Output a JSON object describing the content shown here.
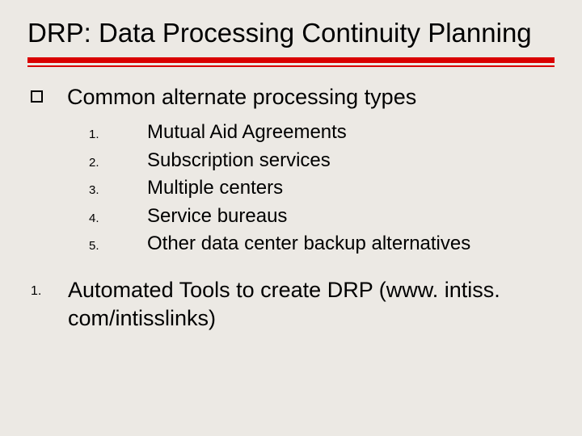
{
  "title": "DRP: Data Processing Continuity Planning",
  "bullet1": {
    "heading": "Common alternate processing types",
    "items": [
      {
        "n": "1.",
        "text": "Mutual Aid Agreements"
      },
      {
        "n": "2.",
        "text": "Subscription services"
      },
      {
        "n": "3.",
        "text": "Multiple centers"
      },
      {
        "n": "4.",
        "text": "Service bureaus"
      },
      {
        "n": "5.",
        "text": "Other data center backup alternatives"
      }
    ]
  },
  "bullet2": {
    "n": "1.",
    "text": "Automated Tools to create DRP (www. intiss. com/intisslinks)"
  }
}
